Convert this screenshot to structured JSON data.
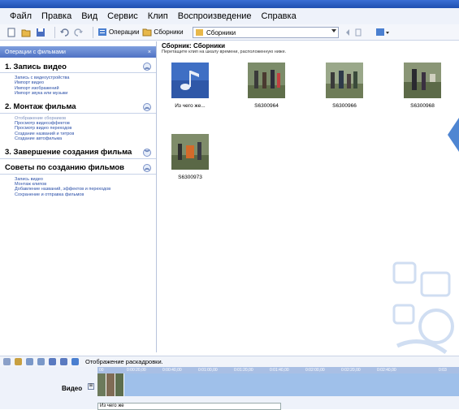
{
  "menu": [
    "Файл",
    "Правка",
    "Вид",
    "Сервис",
    "Клип",
    "Воспроизведение",
    "Справка"
  ],
  "toolbar": {
    "operations_label": "Операции",
    "collections_label": "Сборники",
    "collection_select": "Сборники"
  },
  "left_panel": {
    "header": "Операции с фильмами",
    "close": "×",
    "sections": [
      {
        "title": "1. Запись видео",
        "state": "collapse",
        "links": [
          "Запись с видеоустройства",
          "Импорт видео",
          "Импорт изображений",
          "Импорт звука или музыки"
        ]
      },
      {
        "title": "2. Монтаж фильма",
        "state": "collapse",
        "links": [
          "Отображение сборников",
          "Просмотр видеоэффектов",
          "Просмотр видео переходов",
          "Создание названий и титров",
          "Создание автофильма"
        ]
      },
      {
        "title": "3. Завершение создания фильма",
        "state": "expand",
        "links": []
      },
      {
        "title": "Советы по созданию фильмов",
        "state": "collapse",
        "links": [
          "Запись видео",
          "Монтаж клипов",
          "Добавление названий, эффектов и переходов",
          "Сохранение и отправка фильмов"
        ]
      }
    ]
  },
  "collection": {
    "title": "Сборник: Сборники",
    "subtitle": "Перетащите клип на шкалу времени, расположенную ниже.",
    "items": [
      {
        "caption": "Из чего же...",
        "kind": "audio",
        "icon": "music-note-icon"
      },
      {
        "caption": "S6300964",
        "kind": "video",
        "icon": "video-clip-icon"
      },
      {
        "caption": "S6300966",
        "kind": "video",
        "icon": "video-clip-icon"
      },
      {
        "caption": "S6300968",
        "kind": "video",
        "icon": "video-clip-icon"
      },
      {
        "caption": "S6300973",
        "kind": "video",
        "icon": "video-clip-icon"
      }
    ]
  },
  "storyboard": {
    "toggle_label": "Отображение раскадровки.",
    "video_track_label": "Видео",
    "expand": "⊞",
    "tooltip": "Из чего же",
    "ruler": [
      "00",
      "0:00:20,00",
      "0:00:40,00",
      "0:01:00,00",
      "0:01:20,00",
      "0:01:40,00",
      "0:02:00,00",
      "0:02:20,00",
      "0:02:40,00",
      "0:03"
    ]
  },
  "colors": {
    "accent": "#4f72c4",
    "link": "#2a4fa8",
    "timeline_track": "#9fc0ea"
  }
}
